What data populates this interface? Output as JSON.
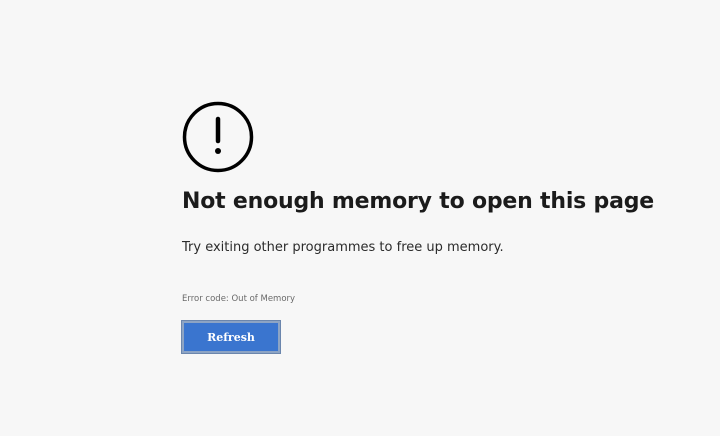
{
  "error_page": {
    "icon": "exclamation-circle-icon",
    "title": "Not enough memory to open this page",
    "message": "Try exiting other programmes to free up memory.",
    "error_code": "Error code: Out of Memory",
    "refresh_label": "Refresh"
  },
  "colors": {
    "background": "#f7f7f7",
    "button": "#3a75cf",
    "text": "#1b1b1b"
  }
}
